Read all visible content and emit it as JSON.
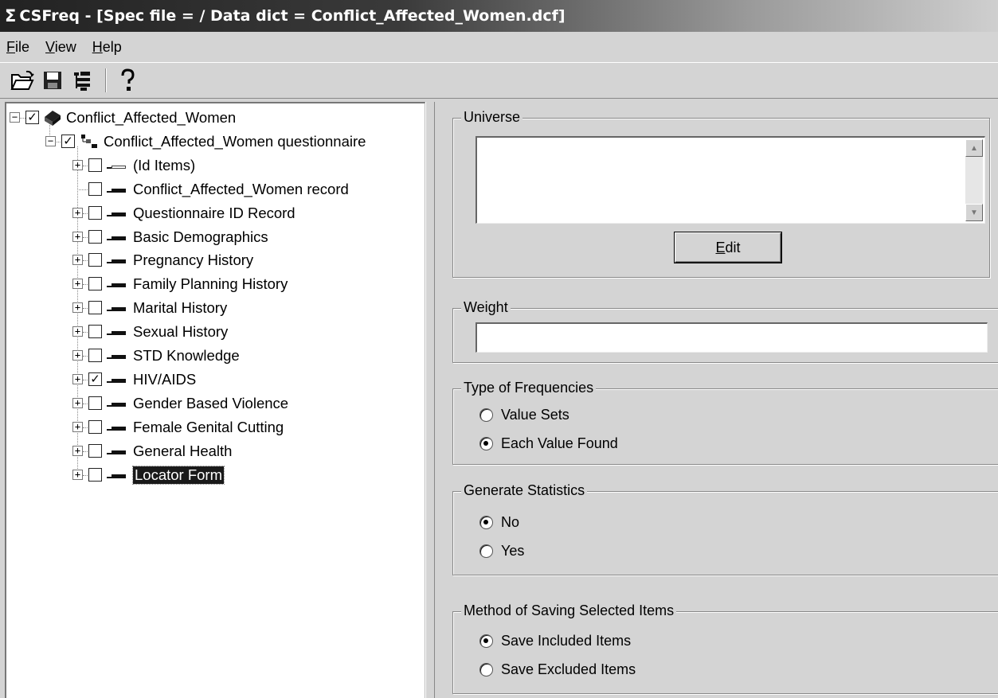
{
  "window": {
    "title": "CSFreq - [Spec file =  / Data dict = Conflict_Affected_Women.dcf]",
    "title_icon": "sigma-icon"
  },
  "menu": [
    {
      "label": "File",
      "key": "F",
      "rest": "ile"
    },
    {
      "label": "View",
      "key": "V",
      "rest": "iew"
    },
    {
      "label": "Help",
      "key": "H",
      "rest": "elp"
    }
  ],
  "toolbar": {
    "buttons": [
      "open-folder-icon",
      "save-disk-icon",
      "tree-run-icon",
      "help-question-icon"
    ]
  },
  "tree": {
    "root": {
      "label": "Conflict_Affected_Women",
      "checked": true,
      "expanded": true,
      "icon": "dictionary-book-icon"
    },
    "level": {
      "label": "Conflict_Affected_Women questionnaire",
      "checked": true,
      "expanded": true,
      "icon": "level-icon"
    },
    "records": [
      {
        "label": "(Id Items)",
        "checked": false,
        "expandable": true
      },
      {
        "label": "Conflict_Affected_Women record",
        "checked": false,
        "expandable": false
      },
      {
        "label": "Questionnaire ID Record",
        "checked": false,
        "expandable": true
      },
      {
        "label": "Basic Demographics",
        "checked": false,
        "expandable": true
      },
      {
        "label": "Pregnancy History",
        "checked": false,
        "expandable": true
      },
      {
        "label": "Family Planning History",
        "checked": false,
        "expandable": true
      },
      {
        "label": "Marital History",
        "checked": false,
        "expandable": true
      },
      {
        "label": "Sexual History",
        "checked": false,
        "expandable": true
      },
      {
        "label": "STD Knowledge",
        "checked": false,
        "expandable": true
      },
      {
        "label": "HIV/AIDS",
        "checked": true,
        "expandable": true
      },
      {
        "label": "Gender Based Violence",
        "checked": false,
        "expandable": true
      },
      {
        "label": "Female Genital Cutting",
        "checked": false,
        "expandable": true
      },
      {
        "label": "General Health",
        "checked": false,
        "expandable": true
      },
      {
        "label": "Locator Form",
        "checked": false,
        "expandable": true,
        "selected": true
      }
    ]
  },
  "universe": {
    "title": "Universe",
    "value": "",
    "edit_label": "Edit"
  },
  "weight": {
    "title": "Weight",
    "value": ""
  },
  "frequencies": {
    "title": "Type of Frequencies",
    "options": [
      "Value Sets",
      "Each Value Found"
    ],
    "selected": "Each Value Found"
  },
  "statistics": {
    "title": "Generate Statistics",
    "options": [
      "No",
      "Yes"
    ],
    "selected": "No"
  },
  "saving": {
    "title": "Method of Saving Selected Items",
    "options": [
      "Save Included Items",
      "Save Excluded Items"
    ],
    "selected": "Save Included Items"
  }
}
